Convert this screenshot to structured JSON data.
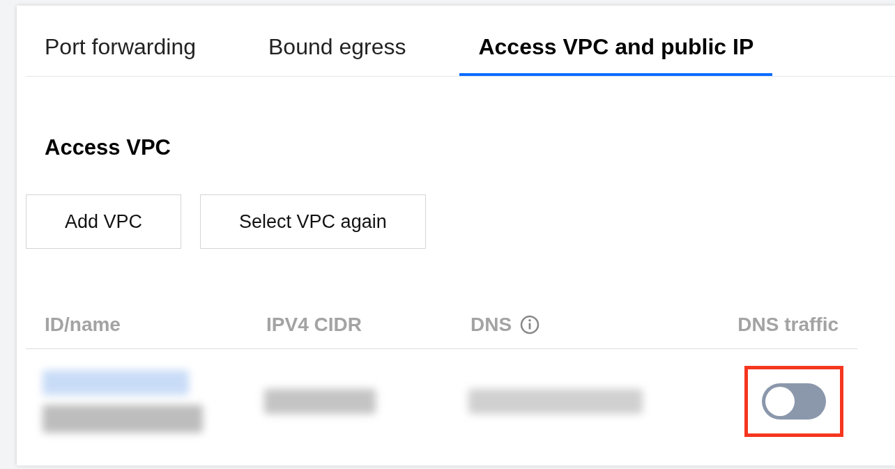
{
  "tabs": [
    {
      "label": "Port forwarding",
      "selected": false
    },
    {
      "label": "Bound egress",
      "selected": false
    },
    {
      "label": "Access VPC and public IP",
      "selected": true
    }
  ],
  "section": {
    "title": "Access VPC",
    "buttons": [
      "Add VPC",
      "Select VPC again"
    ]
  },
  "table": {
    "columns": [
      {
        "label": "ID/name",
        "kind": "text"
      },
      {
        "label": "IPV4 CIDR",
        "kind": "text"
      },
      {
        "label": "DNS",
        "kind": "info"
      },
      {
        "label": "DNS traffic",
        "kind": "right"
      }
    ],
    "rows": [
      {
        "dns_traffic": {
          "on": false,
          "highlighted": true
        }
      }
    ]
  }
}
